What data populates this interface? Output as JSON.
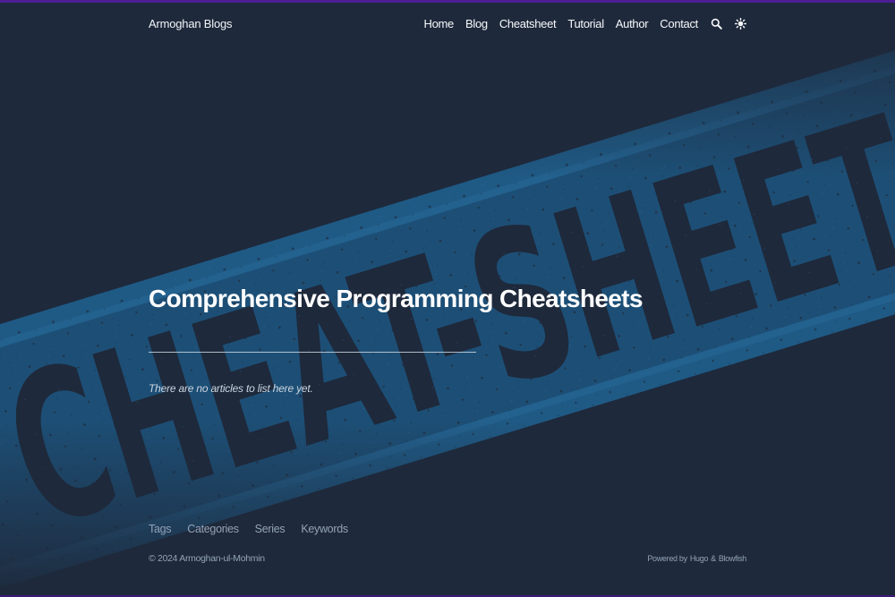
{
  "site": {
    "brand": "Armoghan Blogs"
  },
  "nav": {
    "items": [
      {
        "label": "Home"
      },
      {
        "label": "Blog"
      },
      {
        "label": "Cheatsheet"
      },
      {
        "label": "Tutorial"
      },
      {
        "label": "Author"
      },
      {
        "label": "Contact"
      }
    ],
    "search_icon": "search-icon",
    "appearance_icon": "sun-icon"
  },
  "hero": {
    "stamp_text": "CHEAT SHEET"
  },
  "main": {
    "title": "Comprehensive Programming Cheatsheets",
    "empty_message": "There are no articles to list here yet."
  },
  "footer": {
    "links": [
      {
        "label": "Tags"
      },
      {
        "label": "Categories"
      },
      {
        "label": "Series"
      },
      {
        "label": "Keywords"
      }
    ],
    "copyright": "© 2024 Armoghan-ul-Mohmin",
    "powered_prefix": "Powered by",
    "powered_hugo": "Hugo",
    "powered_amp": "&",
    "powered_blowfish": "Blowfish"
  },
  "colors": {
    "background": "#1e293b",
    "stamp_blue": "#1f5a85",
    "accent_strip": "#4c1d95",
    "text_light": "#f8fafc",
    "text_muted": "#94a3b8"
  }
}
